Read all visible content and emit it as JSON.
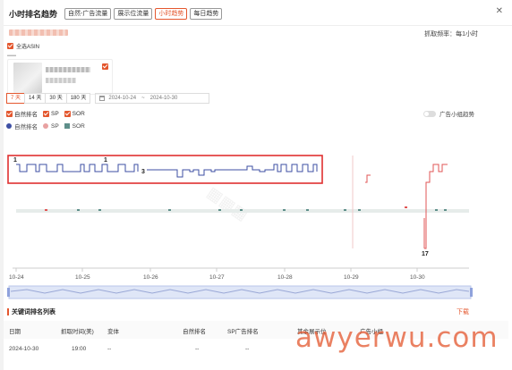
{
  "header": {
    "title": "小时排名趋势",
    "tabs": [
      {
        "label": "自然-广告流量",
        "active": false
      },
      {
        "label": "展示位流量",
        "active": false
      },
      {
        "label": "小时趋势",
        "active": true
      },
      {
        "label": "每日趋势",
        "active": false
      }
    ],
    "close_icon": "close-icon"
  },
  "fetch_frequency": "抓取频率：每1小时",
  "asin": {
    "select_all_label": "全选ASIN",
    "select_all_checked": true
  },
  "ranges": {
    "buttons": [
      {
        "label": "7 天",
        "active": true
      },
      {
        "label": "14 天",
        "active": false
      },
      {
        "label": "30 天",
        "active": false
      },
      {
        "label": "180 天",
        "active": false
      }
    ],
    "date_start": "2024-10-24",
    "date_sep": "~",
    "date_end": "2024-10-30"
  },
  "filters": {
    "items": [
      {
        "label": "自然排名",
        "checked": true
      },
      {
        "label": "SP",
        "checked": true
      },
      {
        "label": "SOR",
        "checked": true
      }
    ],
    "ad_group_toggle_label": "广告小组趋势",
    "ad_group_toggle_on": false
  },
  "legend": [
    {
      "label": "自然排名",
      "color": "#3d4fa3",
      "shape": "dot"
    },
    {
      "label": "SP",
      "color": "#e8a1a1",
      "shape": "dot"
    },
    {
      "label": "SOR",
      "color": "#5e8f8a",
      "shape": "square"
    }
  ],
  "chart_data": {
    "type": "line",
    "x_ticks": [
      "10-24",
      "10-25",
      "10-26",
      "10-27",
      "10-28",
      "10-29",
      "10-30"
    ],
    "annotations": [
      "1",
      "1",
      "3",
      "17"
    ],
    "series": [
      {
        "name": "自然排名",
        "color": "#3d4fa3"
      },
      {
        "name": "SP",
        "color": "#e05555"
      },
      {
        "name": "SOR",
        "color": "#5e8f8a"
      }
    ],
    "highlight_color": "#e03030"
  },
  "keyword_table": {
    "title": "关键词排名列表",
    "download_label": "下载",
    "columns": [
      "日期",
      "抓取时间(美)",
      "变体",
      "自然排名",
      "SP广告排名",
      "其余展示位",
      "广告小组"
    ],
    "rows": [
      [
        "2024-10-30",
        "19:00",
        "--",
        "--",
        "--",
        "",
        ""
      ]
    ]
  },
  "watermark": "awyerwu.com"
}
